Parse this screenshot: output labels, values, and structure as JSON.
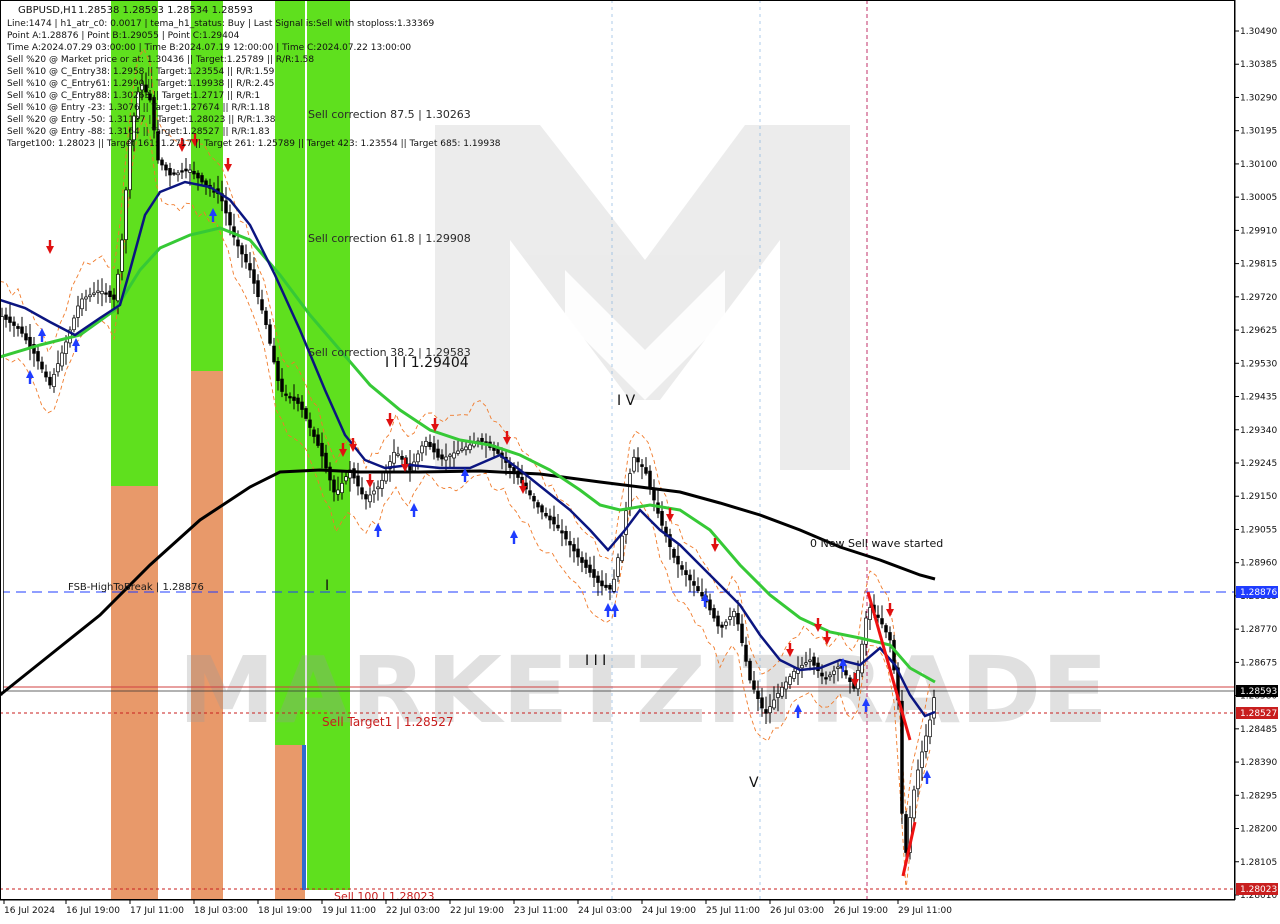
{
  "window": {
    "symbol": "GBPUSD,H1",
    "ohlc": "1.28538 1.28593 1.28534 1.28593"
  },
  "info_lines": [
    "Line:1474  |  h1_atr_c0: 0.0017  |  tema_h1_status: Buy  |  Last Signal is:Sell with stoploss:1.33369",
    "Point A:1.28876  |  Point B:1.29055  |  Point C:1.29404",
    "Time A:2024.07.29 03:00:00  |  Time B:2024.07.19 12:00:00  |  Time C:2024.07.22 13:00:00",
    "Sell %20 @ Market price or at: 1.30436  ||  Target:1.25789  ||  R/R:1.58",
    "Sell %10 @ C_Entry38: 1.2958  ||  Target:1.23554  ||  R/R:1.59",
    "Sell %10 @ C_Entry61: 1.2990  ||  Target:1.19938  ||  R/R:2.45",
    "Sell %10 @ C_Entry88: 1.30263  ||  Target:1.2717  ||  R/R:1",
    "Sell %10 @ Entry -23: 1.3076  ||  Target:1.27674  ||  R/R:1.18",
    "Sell %20 @ Entry -50: 1.31127  ||  Target:1.28023  ||  R/R:1.38",
    "Sell %20 @ Entry -88: 1.3164  ||  Target:1.28527  ||  R/R:1.83",
    "Target100: 1.28023  ||  Target 161: 1.2717  ||  Target 261: 1.25789  ||  Target 423: 1.23554  ||  Target 685: 1.19938"
  ],
  "chart_labels": {
    "sell_corr_875": "Sell correction 87.5 | 1.30263",
    "sell_corr_618": "Sell correction 61.8 | 1.29908",
    "sell_corr_382": "Sell correction 38.2 | 1.29583",
    "wave_c_label": "I I I 1.29404",
    "wave_iv": "I V",
    "wave_v": "V",
    "wave_i": "I",
    "wave_iii": "I I I",
    "new_sell_wave": "0 New Sell wave started",
    "fsb_label": "FSB-HighToBreak  |  1.28876",
    "sell_target1": "Sell Target1  |  1.28527",
    "sell_100": "Sell 100 | 1.28023",
    "watermark": "MARKETZITRADE"
  },
  "price_axis": {
    "ticks": [
      "1.30490",
      "1.30385",
      "1.30290",
      "1.30195",
      "1.30100",
      "1.30005",
      "1.29910",
      "1.29815",
      "1.29720",
      "1.29625",
      "1.29530",
      "1.29435",
      "1.29340",
      "1.29245",
      "1.29150",
      "1.29055",
      "1.28960",
      "1.28865",
      "1.28770",
      "1.28675",
      "1.28580",
      "1.28485",
      "1.28390",
      "1.28295",
      "1.28200",
      "1.28105",
      "1.28010"
    ],
    "tags": [
      {
        "text": "1.28876",
        "color": "#1f3cff"
      },
      {
        "text": "1.28593",
        "color": "#000000"
      },
      {
        "text": "1.28527",
        "color": "#c81e1e"
      },
      {
        "text": "1.28023",
        "color": "#c81e1e"
      }
    ]
  },
  "time_axis": {
    "ticks": [
      "16 Jul 2024",
      "16 Jul 19:00",
      "17 Jul 11:00",
      "18 Jul 03:00",
      "18 Jul 19:00",
      "19 Jul 11:00",
      "22 Jul 03:00",
      "22 Jul 19:00",
      "23 Jul 11:00",
      "24 Jul 03:00",
      "24 Jul 19:00",
      "25 Jul 11:00",
      "26 Jul 03:00",
      "26 Jul 19:00",
      "29 Jul 11:00"
    ]
  },
  "colors": {
    "green_zone": "#5fe01e",
    "orange_zone": "#e8996a",
    "ma_green": "#36c936",
    "ma_navy": "#0b1580",
    "ma_black": "#000000",
    "fsb_line": "#1f3cff",
    "target_line": "#c81e1e",
    "up_arrow": "#1f3cff",
    "down_arrow": "#e01010"
  }
}
